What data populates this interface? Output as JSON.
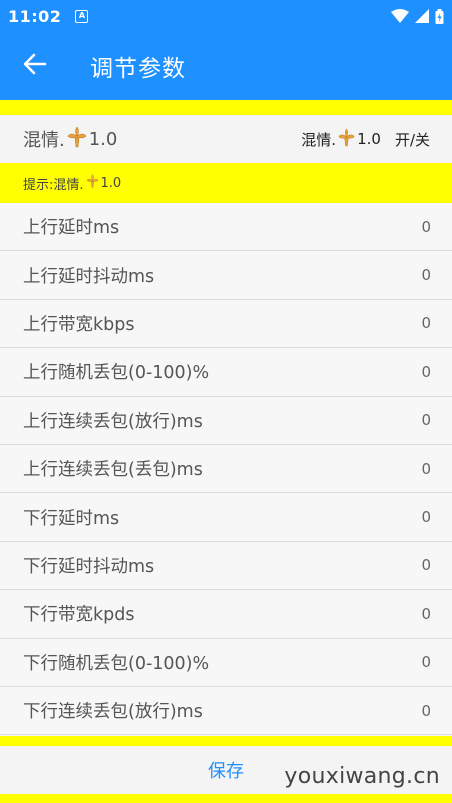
{
  "status_bar": {
    "time": "11:02",
    "notification_glyph": "A"
  },
  "app_bar": {
    "title": "调节参数"
  },
  "toggle": {
    "left_prefix": "混情.",
    "left_suffix": "1.0",
    "right_prefix": "混情.",
    "right_suffix": "1.0",
    "switch_label": "开/关"
  },
  "hint": {
    "prefix": "提示:混情.",
    "suffix": "1.0"
  },
  "params": [
    {
      "label": "上行延时ms",
      "value": "0"
    },
    {
      "label": "上行延时抖动ms",
      "value": "0"
    },
    {
      "label": "上行带宽kbps",
      "value": "0"
    },
    {
      "label": "上行随机丢包(0-100)%",
      "value": "0"
    },
    {
      "label": "上行连续丢包(放行)ms",
      "value": "0"
    },
    {
      "label": "上行连续丢包(丢包)ms",
      "value": "0"
    },
    {
      "label": "下行延时ms",
      "value": "0"
    },
    {
      "label": "下行延时抖动ms",
      "value": "0"
    },
    {
      "label": "下行带宽kpds",
      "value": "0"
    },
    {
      "label": "下行随机丢包(0-100)%",
      "value": "0"
    },
    {
      "label": "下行连续丢包(放行)ms",
      "value": "0"
    }
  ],
  "save_label": "保存",
  "watermark": "youxiwang.cn",
  "colors": {
    "accent": "#1e90ff",
    "highlight": "#ffff00",
    "icon_gold": "#e8a33c"
  }
}
